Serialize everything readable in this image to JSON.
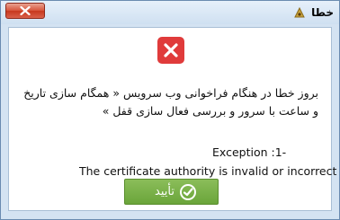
{
  "window": {
    "title": "خطا",
    "app_icon": "app-logo-icon",
    "close_icon": "close-icon"
  },
  "dialog": {
    "icon": "error-x-icon",
    "icon_color": "#e03b3b",
    "message_lines": [
      "بروز خطا در هنگام فراخوانی وب سرویس « همگام سازی تاریخ",
      "و ساعت با سرور و بررسی فعال سازی قفل »"
    ],
    "exception_line": "Exception :1-",
    "detail_line": "The certificate authority is invalid or incorrect",
    "ok_button": {
      "label": "تأیید",
      "icon": "check-circle-icon",
      "color": "#72ab40"
    }
  }
}
